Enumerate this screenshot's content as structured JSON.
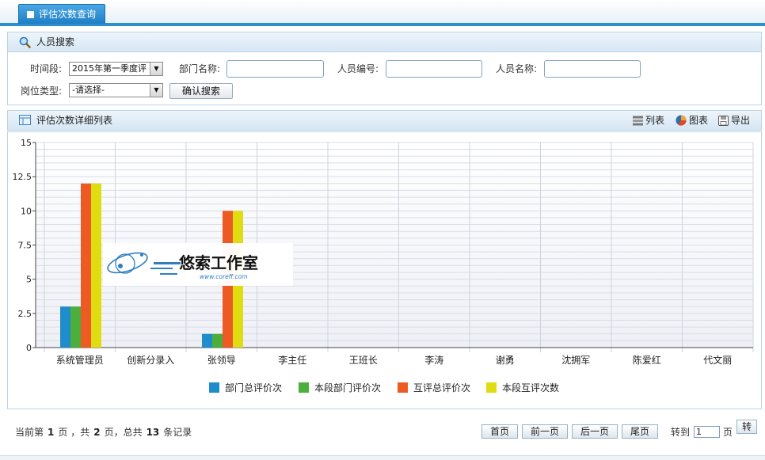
{
  "tab": {
    "label": "评估次数查询"
  },
  "search_panel": {
    "title": "人员搜索",
    "period_label": "时间段:",
    "period_value": "2015年第一季度评",
    "dept_label": "部门名称:",
    "dept_value": "",
    "emp_no_label": "人员编号:",
    "emp_no_value": "",
    "emp_name_label": "人员名称:",
    "emp_name_value": "",
    "post_label": "岗位类型:",
    "post_value": "-请选择-",
    "confirm_label": "确认搜索"
  },
  "list_panel": {
    "title": "评估次数详细列表",
    "list_label": "列表",
    "chart_label": "图表",
    "export_label": "导出"
  },
  "watermark": {
    "title": "悠索工作室",
    "url": "www.coreff.com"
  },
  "chart_data": {
    "type": "bar",
    "categories": [
      "系统管理员",
      "创新分录入",
      "张领导",
      "李主任",
      "王班长",
      "李涛",
      "谢勇",
      "沈拥军",
      "陈爱红",
      "代文丽"
    ],
    "series": [
      {
        "name": "部门总评价次",
        "color": "#1f8dcc",
        "values": [
          3,
          0,
          1,
          0,
          0,
          0,
          0,
          0,
          0,
          0
        ]
      },
      {
        "name": "本段部门评价次",
        "color": "#4caf3c",
        "values": [
          3,
          0,
          1,
          0,
          0,
          0,
          0,
          0,
          0,
          0
        ]
      },
      {
        "name": "互评总评价次",
        "color": "#ee5a24",
        "values": [
          12,
          0,
          10,
          0,
          0,
          0,
          0,
          0,
          0,
          0
        ]
      },
      {
        "name": "本段互评次数",
        "color": "#e0dc12",
        "values": [
          12,
          0,
          10,
          0,
          0,
          0,
          0,
          0,
          0,
          0
        ]
      }
    ],
    "yticks": [
      "0",
      "2.5",
      "5",
      "7.5",
      "10",
      "12.5",
      "15"
    ],
    "ylim": [
      0,
      15
    ],
    "grid": true,
    "legend": "bottom"
  },
  "pager": {
    "current_prefix": "当前第",
    "current_page": "1",
    "total_prefix": "页 ，共",
    "total_pages": "2",
    "records_prefix": "页，总共",
    "total_records": "13",
    "records_suffix": "条记录",
    "first": "首页",
    "prev": "前一页",
    "next": "后一页",
    "last": "尾页",
    "goto_label": "转到",
    "goto_value": "1",
    "page_unit": "页",
    "go": "转"
  }
}
